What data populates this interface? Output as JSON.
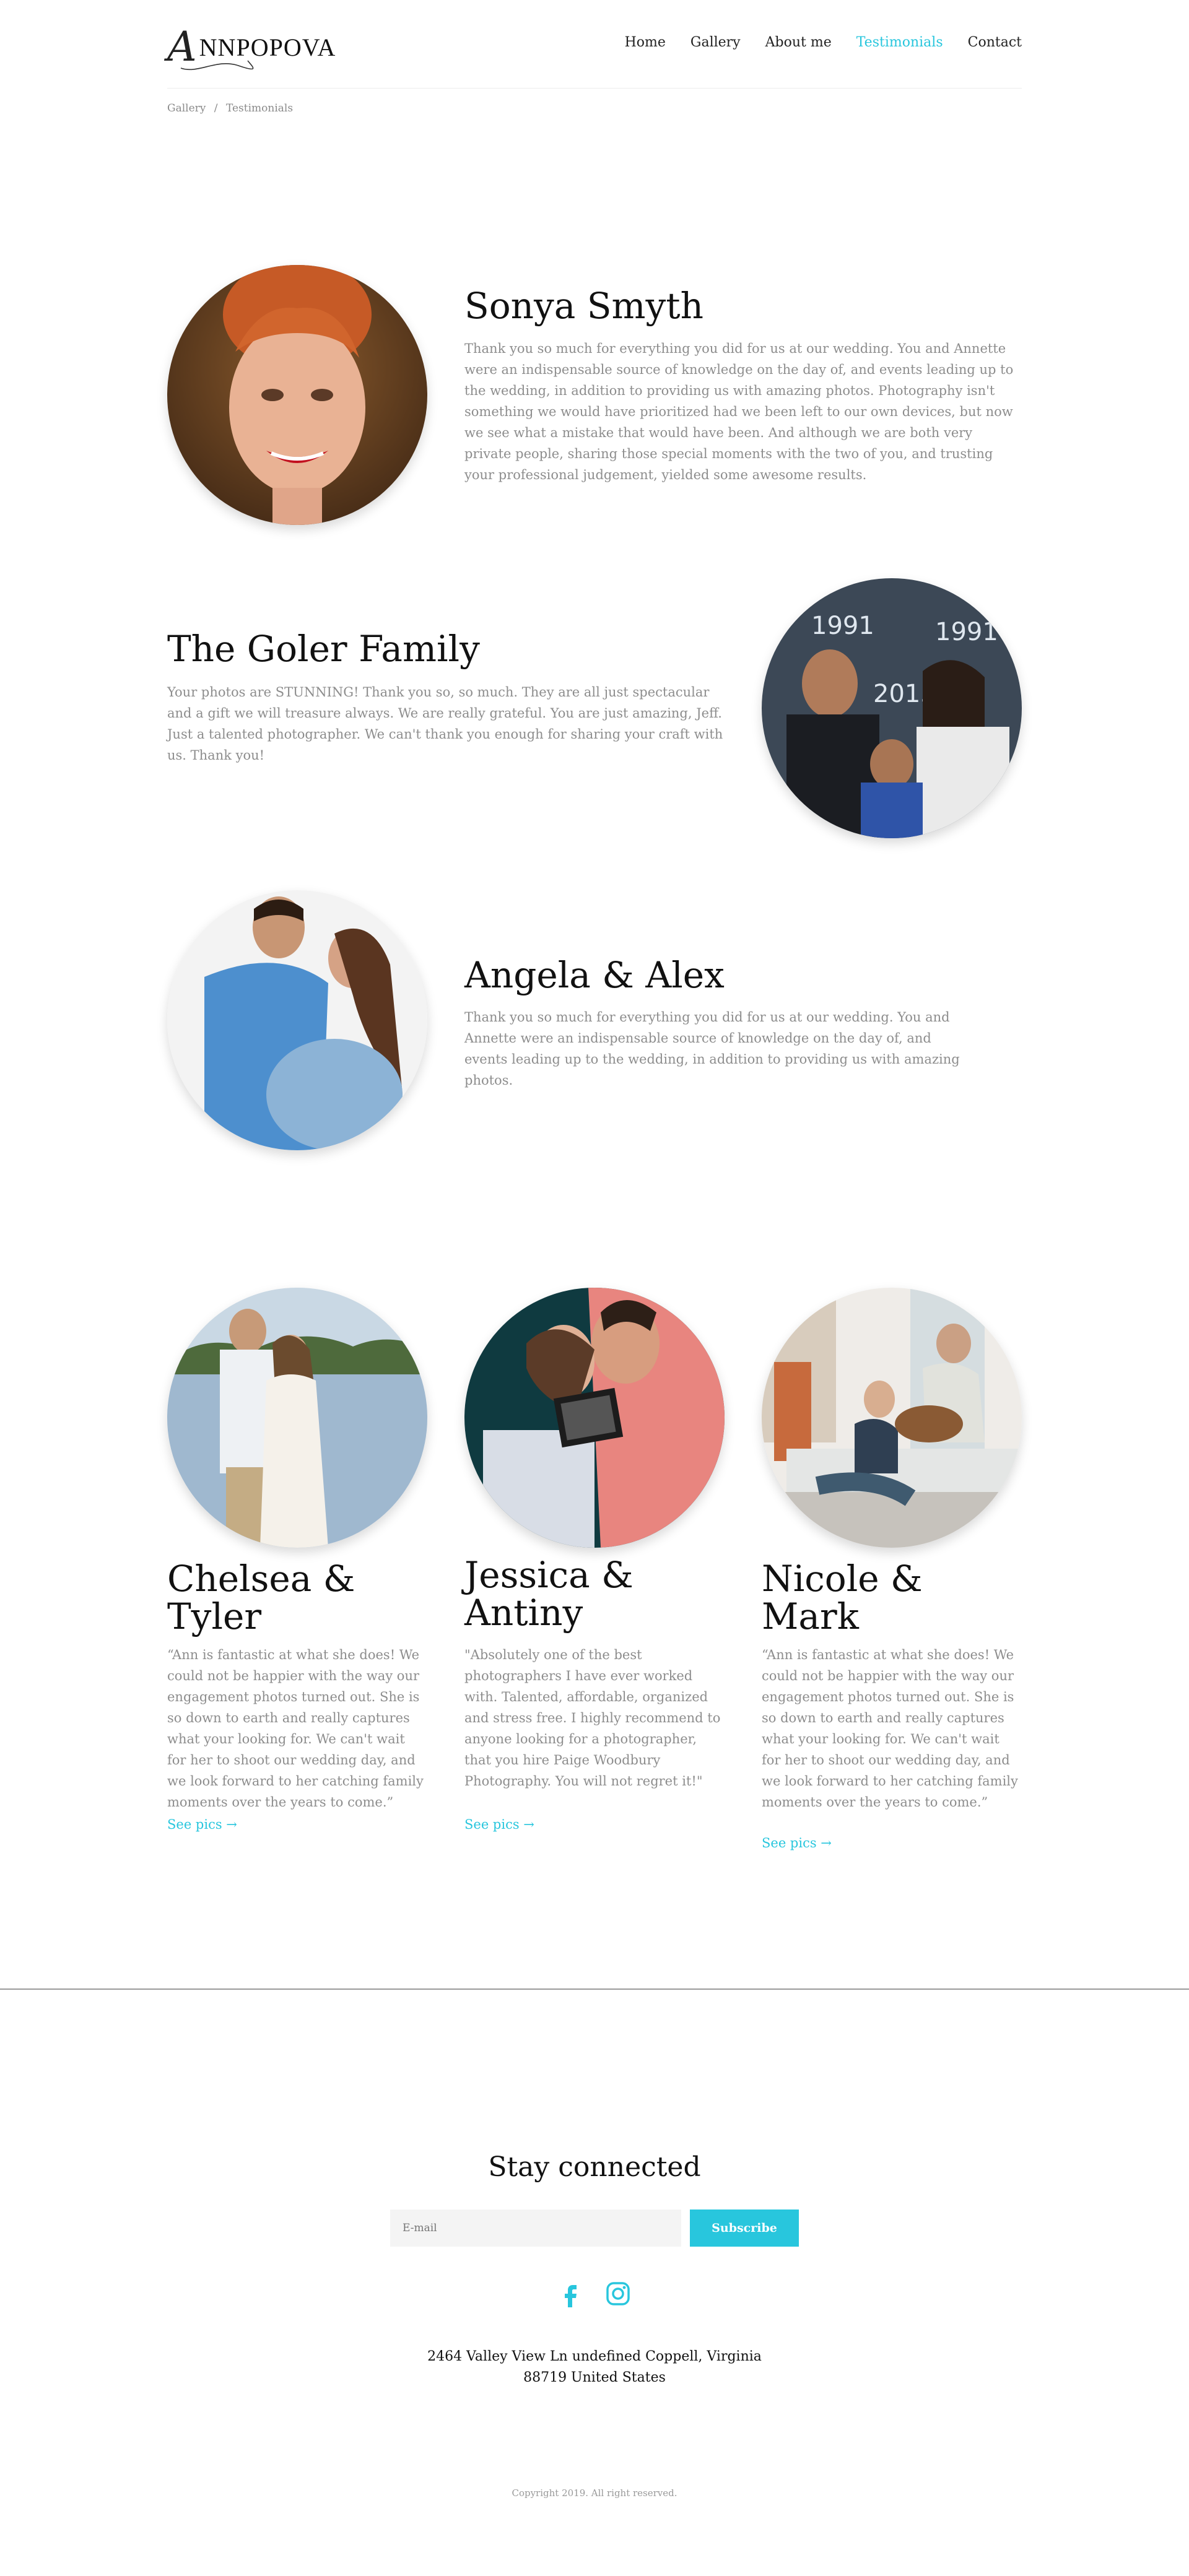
{
  "brand": {
    "monogram": "A",
    "name": "NNPOPOVA"
  },
  "nav": {
    "items": [
      {
        "label": "Home"
      },
      {
        "label": "Gallery"
      },
      {
        "label": "About me"
      },
      {
        "label": "Testimonials"
      },
      {
        "label": "Contact"
      }
    ],
    "active": "Testimonials"
  },
  "breadcrumb": {
    "items": [
      "Gallery",
      "Testimonials"
    ],
    "separator": "/"
  },
  "testimonials": [
    {
      "name": "Sonya Smyth",
      "text": "Thank you so much for everything you did for us at our wedding. You and Annette were an indispensable source of knowledge on the day of, and events leading up to the wedding, in addition to providing us with amazing photos. Photography isn't something we would have prioritized had we been left to our own devices, but now we see what a mistake that would have been. And although we are both very private people, sharing those special moments with the two of you, and trusting your professional judgement, yielded some awesome results."
    },
    {
      "name": "The Goler Family",
      "text": "Your photos are STUNNING! Thank you so, so much. They are all just spectacular and a gift we will treasure always. We are really grateful. You are just amazing, Jeff. Just a talented photographer. We can't thank you enough for sharing your craft with us. Thank you!"
    },
    {
      "name": "Angela & Alex",
      "text": "Thank you so much for everything you did for us at our wedding. You and Annette were an indispensable source of knowledge on the day of, and events leading up to the wedding, in addition to providing us with amazing photos."
    }
  ],
  "cards": [
    {
      "name": "Chelsea & Tyler",
      "text": "“Ann is fantastic at what she does! We could not be happier with the way our engagement photos turned out. She is so down to earth and really captures what your looking for. We can't wait for her to shoot our wedding day, and we look forward to her catching family moments over the years to come.”",
      "link": "See pics →"
    },
    {
      "name": "Jessica & Antiny",
      "text": "\"Absolutely one of the best photographers I have ever worked with. Talented, affordable, organized and stress free. I highly recommend to anyone looking for a photographer, that you hire Paige Woodbury Photography. You will not regret it!\"",
      "link": "See pics →"
    },
    {
      "name": "Nicole & Mark",
      "text": "“Ann is fantastic at what she does! We could not be happier with the way our engagement photos turned out. She is so down to earth and really captures what your looking for. We can't wait for her to shoot our wedding day, and we look forward to her catching family moments over the years to come.”",
      "link": "See pics →"
    }
  ],
  "footer": {
    "title": "Stay connected",
    "email_placeholder": "E-mail",
    "subscribe_label": "Subscribe",
    "address_line1": "2464 Valley View Ln undefined Coppell, Virginia",
    "address_line2": "88719 United States",
    "copyright": "Copyright 2019. All right reserved."
  },
  "colors": {
    "accent": "#28c6dd",
    "text": "#111111",
    "muted": "#8d8d8d"
  },
  "icons": {
    "social": [
      "facebook-icon",
      "instagram-icon"
    ]
  }
}
